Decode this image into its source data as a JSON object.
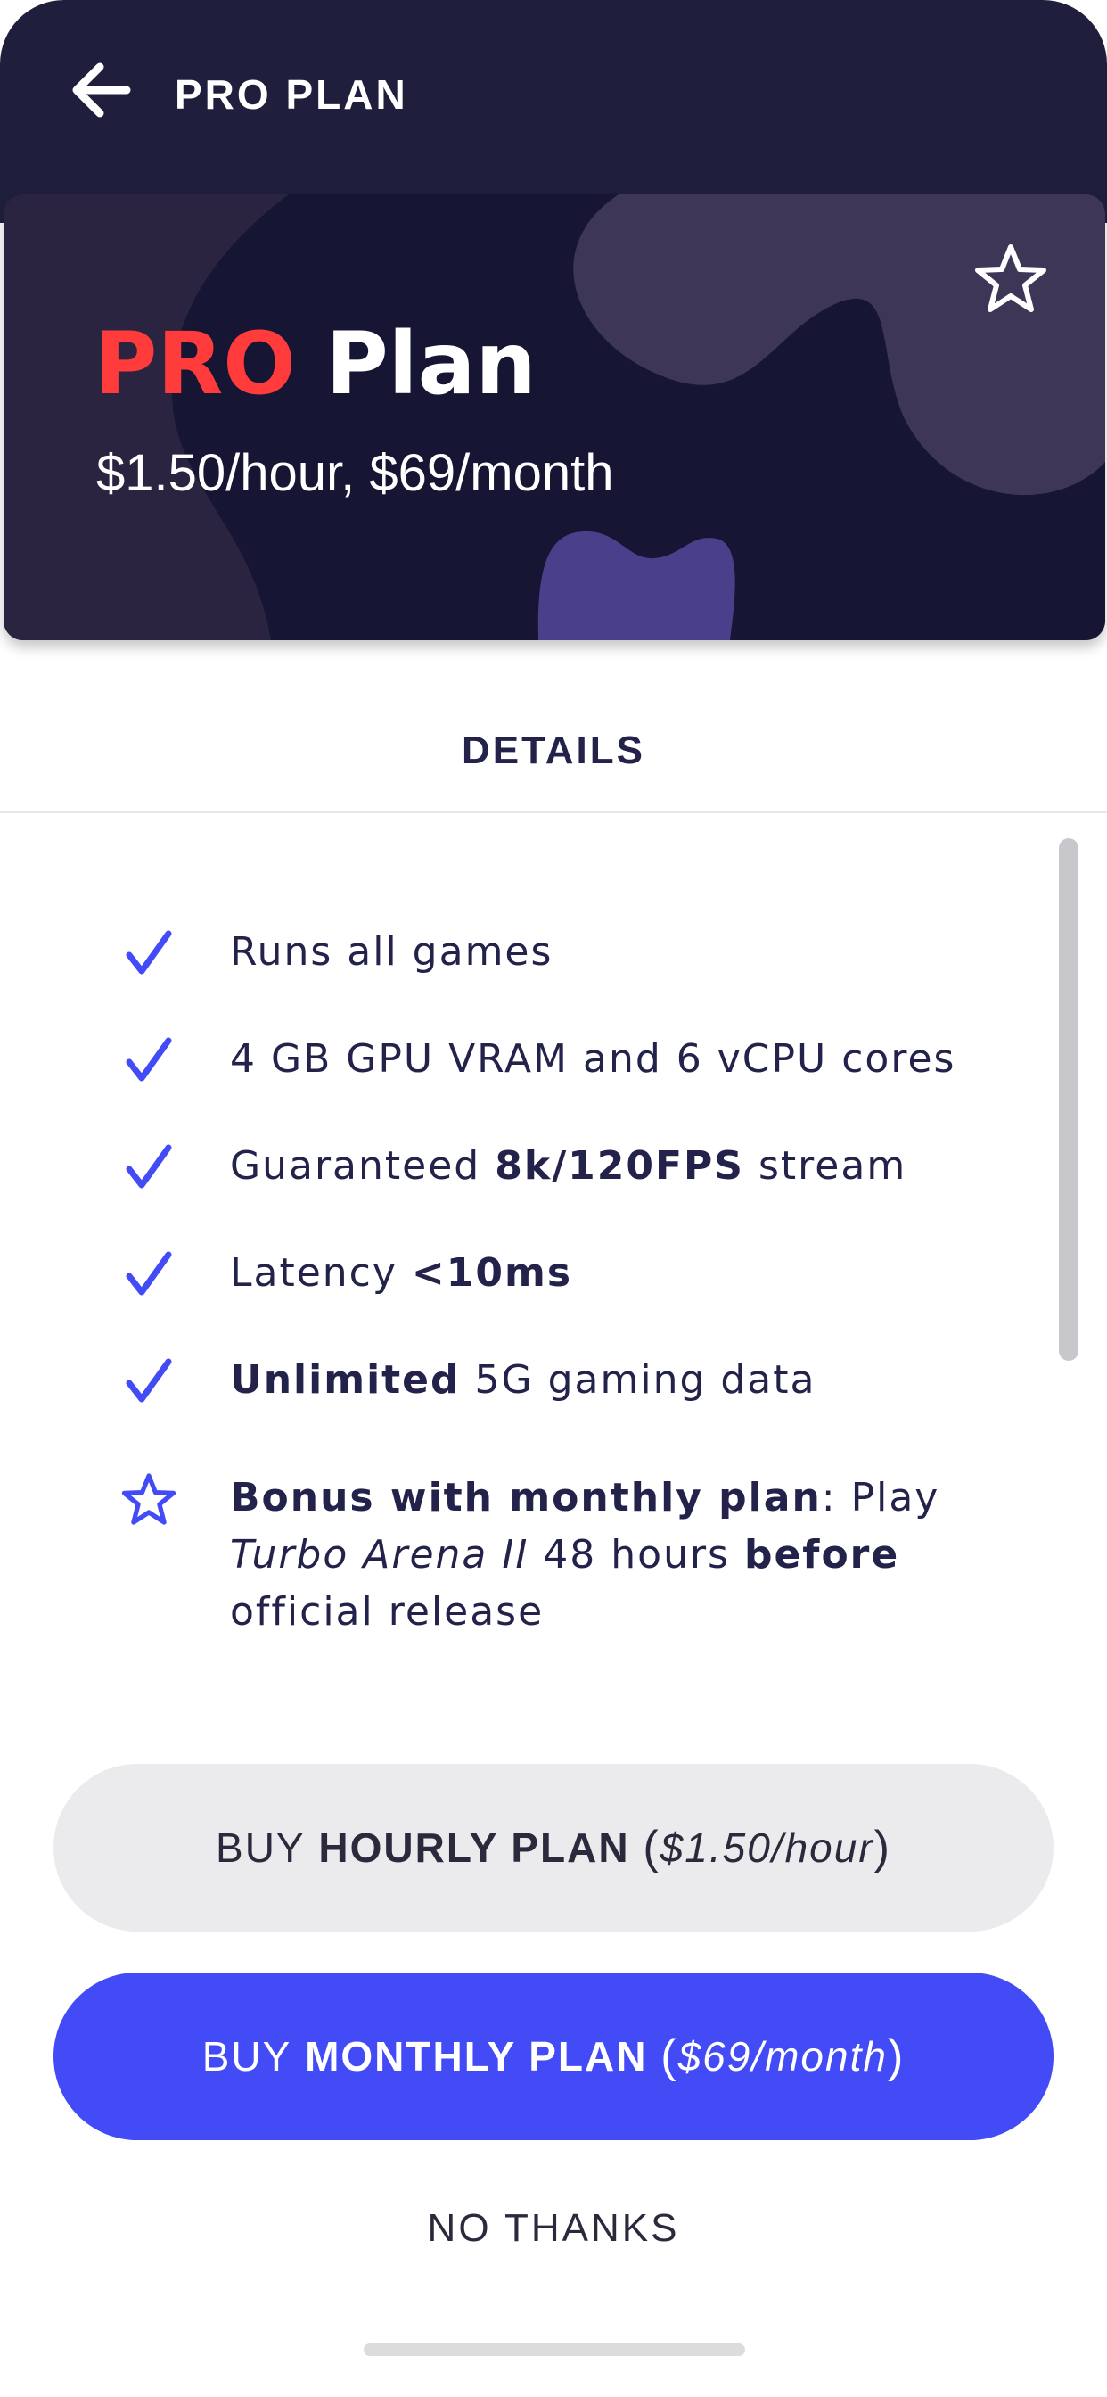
{
  "header": {
    "back_icon": "arrow-left-icon",
    "title": "PRO PLAN"
  },
  "hero": {
    "title_accent": "PRO",
    "title_rest": "Plan",
    "price": "$1.50/hour, $69/month",
    "favorite_icon": "star-outline-icon",
    "colors": {
      "background": "#161533",
      "accent": "#ff3b3b",
      "blob_light": "#3e3657",
      "blob_purple": "#4a3f8a"
    }
  },
  "tabs": {
    "details": "DETAILS"
  },
  "features": [
    {
      "icon": "check-icon",
      "parts": [
        {
          "text": "Runs all games"
        }
      ]
    },
    {
      "icon": "check-icon",
      "parts": [
        {
          "text": "4 GB GPU VRAM and 6 vCPU cores"
        }
      ]
    },
    {
      "icon": "check-icon",
      "parts": [
        {
          "text": "Guaranteed "
        },
        {
          "text": "8k/120FPS",
          "bold": true
        },
        {
          "text": " stream"
        }
      ]
    },
    {
      "icon": "check-icon",
      "parts": [
        {
          "text": "Latency "
        },
        {
          "text": "<10ms",
          "bold": true
        }
      ]
    },
    {
      "icon": "check-icon",
      "parts": [
        {
          "text": "Unlimited",
          "bold": true
        },
        {
          "text": " 5G gaming data"
        }
      ]
    },
    {
      "icon": "star-outline-icon",
      "parts": [
        {
          "text": "Bonus with monthly plan",
          "bold": true
        },
        {
          "text": ": Play "
        },
        {
          "text": "Turbo Arena II",
          "italic": true
        },
        {
          "text": " 48 hours "
        },
        {
          "text": "before",
          "bold": true
        },
        {
          "text": " official release"
        }
      ]
    }
  ],
  "buttons": {
    "hourly": {
      "prefix": "BUY ",
      "plan": "HOURLY PLAN",
      "price": "$1.50/hour"
    },
    "monthly": {
      "prefix": "BUY ",
      "plan": "MONTHLY PLAN",
      "price": "$69/month"
    },
    "no_thanks": "NO THANKS"
  },
  "colors": {
    "topbar": "#1f1f3d",
    "text_dark": "#22224a",
    "primary": "#424bf5",
    "secondary_button": "#ebebed",
    "check": "#424bf5"
  }
}
